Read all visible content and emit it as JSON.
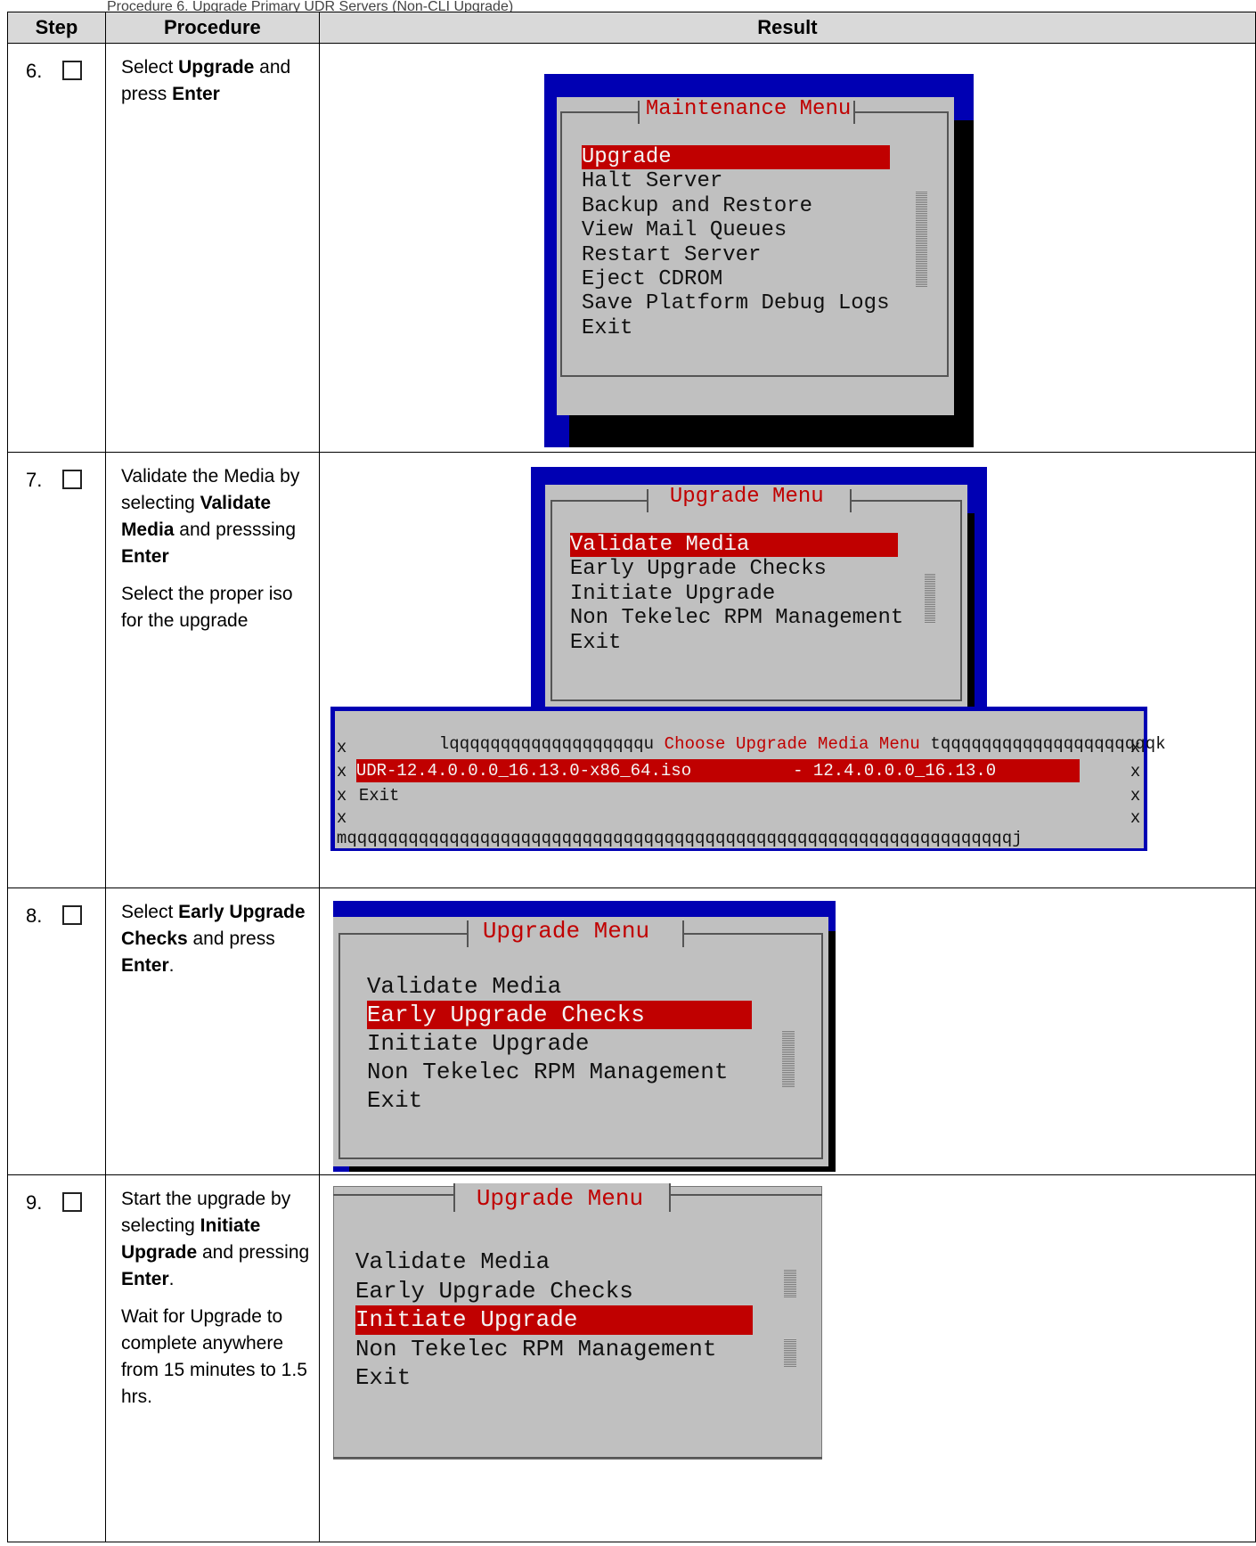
{
  "caption": "Procedure 6. Upgrade Primary UDR Servers (Non-CLI Upgrade)",
  "headers": {
    "step": "Step",
    "procedure": "Procedure",
    "result": "Result"
  },
  "rows": [
    {
      "step": "6.",
      "procedure": [
        [
          "Select ",
          {
            "b": "Upgrade"
          },
          " and press ",
          {
            "b": "Enter"
          }
        ]
      ],
      "maintenance_menu": {
        "title": "Maintenance Menu",
        "items": [
          "Upgrade",
          "Halt Server",
          "Backup and Restore",
          "View Mail Queues",
          "Restart Server",
          "Eject CDROM",
          "Save Platform Debug Logs",
          "Exit"
        ],
        "selected": "Upgrade"
      }
    },
    {
      "step": "7.",
      "procedure": [
        [
          "Validate the Media by selecting ",
          {
            "b": "Validate Media"
          },
          " and presssing ",
          {
            "b": "Enter"
          }
        ],
        [
          "Select the proper iso for the upgrade"
        ]
      ],
      "upgrade_menu": {
        "title": "Upgrade Menu",
        "items": [
          "Validate Media",
          "Early Upgrade Checks",
          "Initiate Upgrade",
          "Non Tekelec RPM Management",
          "Exit"
        ],
        "selected": "Validate Media"
      },
      "media_menu": {
        "top_left": "lqqqqqqqqqqqqqqqqqqqu",
        "title": "Choose Upgrade Media Menu",
        "top_right": "tqqqqqqqqqqqqqqqqqqqqqk",
        "side": "x",
        "iso_option": "UDR-12.4.0.0.0_16.13.0-x86_64.iso          - 12.4.0.0.0_16.13.0",
        "exit_option": "Exit",
        "bottom": "mqqqqqqqqqqqqqqqqqqqqqqqqqqqqqqqqqqqqqqqqqqqqqqqqqqqqqqqqqqqqqqqqqj"
      }
    },
    {
      "step": "8.",
      "procedure": [
        [
          "Select ",
          {
            "b": "Early Upgrade Checks"
          },
          " and press ",
          {
            "b": "Enter"
          },
          "."
        ]
      ],
      "upgrade_menu": {
        "title": "Upgrade Menu",
        "items": [
          "Validate Media",
          "Early Upgrade Checks",
          "Initiate Upgrade",
          "Non Tekelec RPM Management",
          "Exit"
        ],
        "selected": "Early Upgrade Checks"
      }
    },
    {
      "step": "9.",
      "procedure": [
        [
          "Start the upgrade by selecting ",
          {
            "b": "Initiate Upgrade"
          },
          " and pressing ",
          {
            "b": "Enter"
          },
          "."
        ],
        [
          "Wait for Upgrade to complete anywhere from 15 minutes to 1.5 hrs."
        ]
      ],
      "upgrade_menu": {
        "title": "Upgrade Menu",
        "items": [
          "Validate Media",
          "Early Upgrade Checks",
          "Initiate Upgrade",
          "Non Tekelec RPM Management",
          "Exit"
        ],
        "selected": "Initiate Upgrade"
      }
    }
  ],
  "colors": {
    "terminal_bg": "#c0c0c0",
    "highlight": "#c00000",
    "frame_blue": "#0000b3",
    "shadow": "#000000"
  }
}
